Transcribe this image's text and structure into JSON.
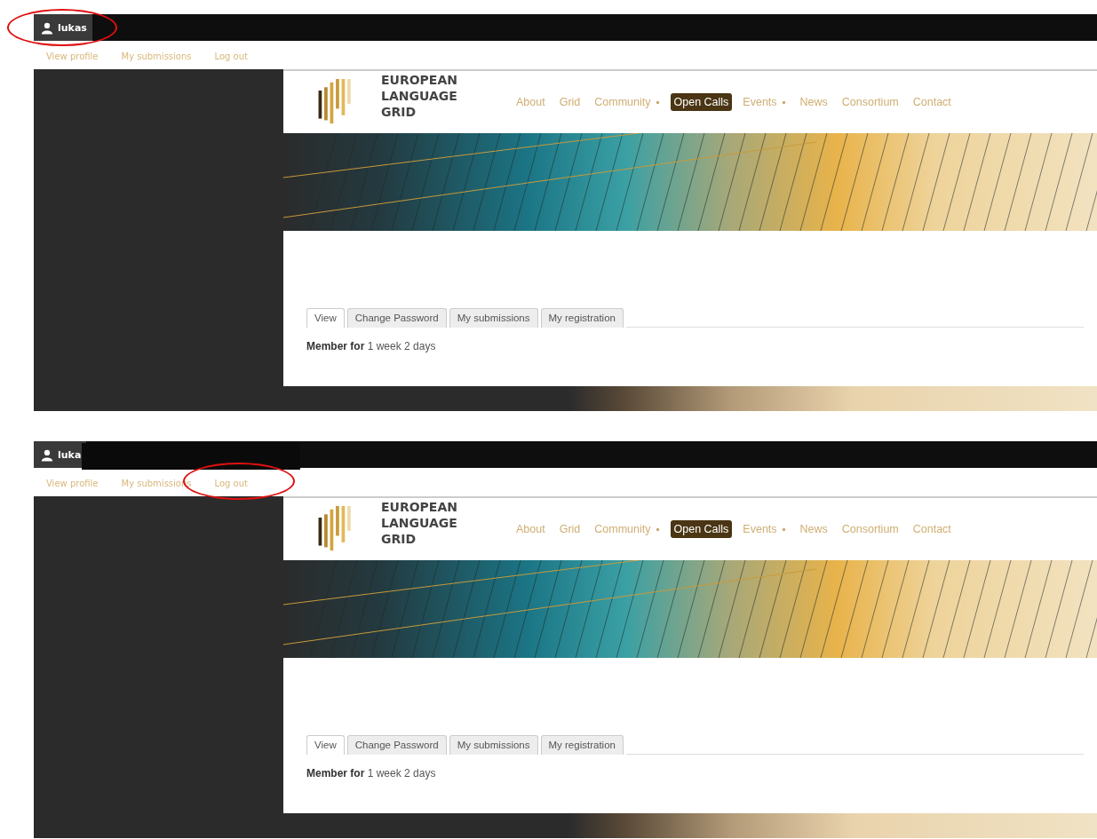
{
  "panels": [
    {
      "user_name": "lukas",
      "name_covered": false,
      "user_circled": true,
      "user_links": [
        {
          "label": "View profile",
          "circled": false
        },
        {
          "label": "My submissions",
          "circled": false
        },
        {
          "label": "Log out",
          "circled": false
        }
      ],
      "logo_lines": [
        "EUROPEAN",
        "LANGUAGE",
        "GRID"
      ],
      "nav": [
        {
          "label": "About",
          "selected": false,
          "dropdown": false
        },
        {
          "label": "Grid",
          "selected": false,
          "dropdown": false
        },
        {
          "label": "Community",
          "selected": false,
          "dropdown": true
        },
        {
          "label": "Open Calls",
          "selected": true,
          "dropdown": false
        },
        {
          "label": "Events",
          "selected": false,
          "dropdown": true
        },
        {
          "label": "News",
          "selected": false,
          "dropdown": false
        },
        {
          "label": "Consortium",
          "selected": false,
          "dropdown": false
        },
        {
          "label": "Contact",
          "selected": false,
          "dropdown": false
        }
      ],
      "tabs": [
        {
          "label": "View",
          "selected": true
        },
        {
          "label": "Change Password",
          "selected": false
        },
        {
          "label": "My submissions",
          "selected": false
        },
        {
          "label": "My registration",
          "selected": false
        }
      ],
      "member_line": "**Member for** 1 week 2 days"
    },
    {
      "user_name": "luka",
      "name_covered": true,
      "user_circled": false,
      "user_links": [
        {
          "label": "View profile",
          "circled": false
        },
        {
          "label": "My submissions",
          "circled": false
        },
        {
          "label": "Log out",
          "circled": true
        }
      ],
      "logo_lines": [
        "EUROPEAN",
        "LANGUAGE",
        "GRID"
      ],
      "nav": [
        {
          "label": "About",
          "selected": false,
          "dropdown": false
        },
        {
          "label": "Grid",
          "selected": false,
          "dropdown": false
        },
        {
          "label": "Community",
          "selected": false,
          "dropdown": true
        },
        {
          "label": "Open Calls",
          "selected": true,
          "dropdown": false
        },
        {
          "label": "Events",
          "selected": false,
          "dropdown": true
        },
        {
          "label": "News",
          "selected": false,
          "dropdown": false
        },
        {
          "label": "Consortium",
          "selected": false,
          "dropdown": false
        },
        {
          "label": "Contact",
          "selected": false,
          "dropdown": false
        }
      ],
      "tabs": [
        {
          "label": "View",
          "selected": true
        },
        {
          "label": "Change Password",
          "selected": false
        },
        {
          "label": "My submissions",
          "selected": false
        },
        {
          "label": "My registration",
          "selected": false
        }
      ],
      "member_line": "**Member for** 1 week 2 days"
    }
  ]
}
